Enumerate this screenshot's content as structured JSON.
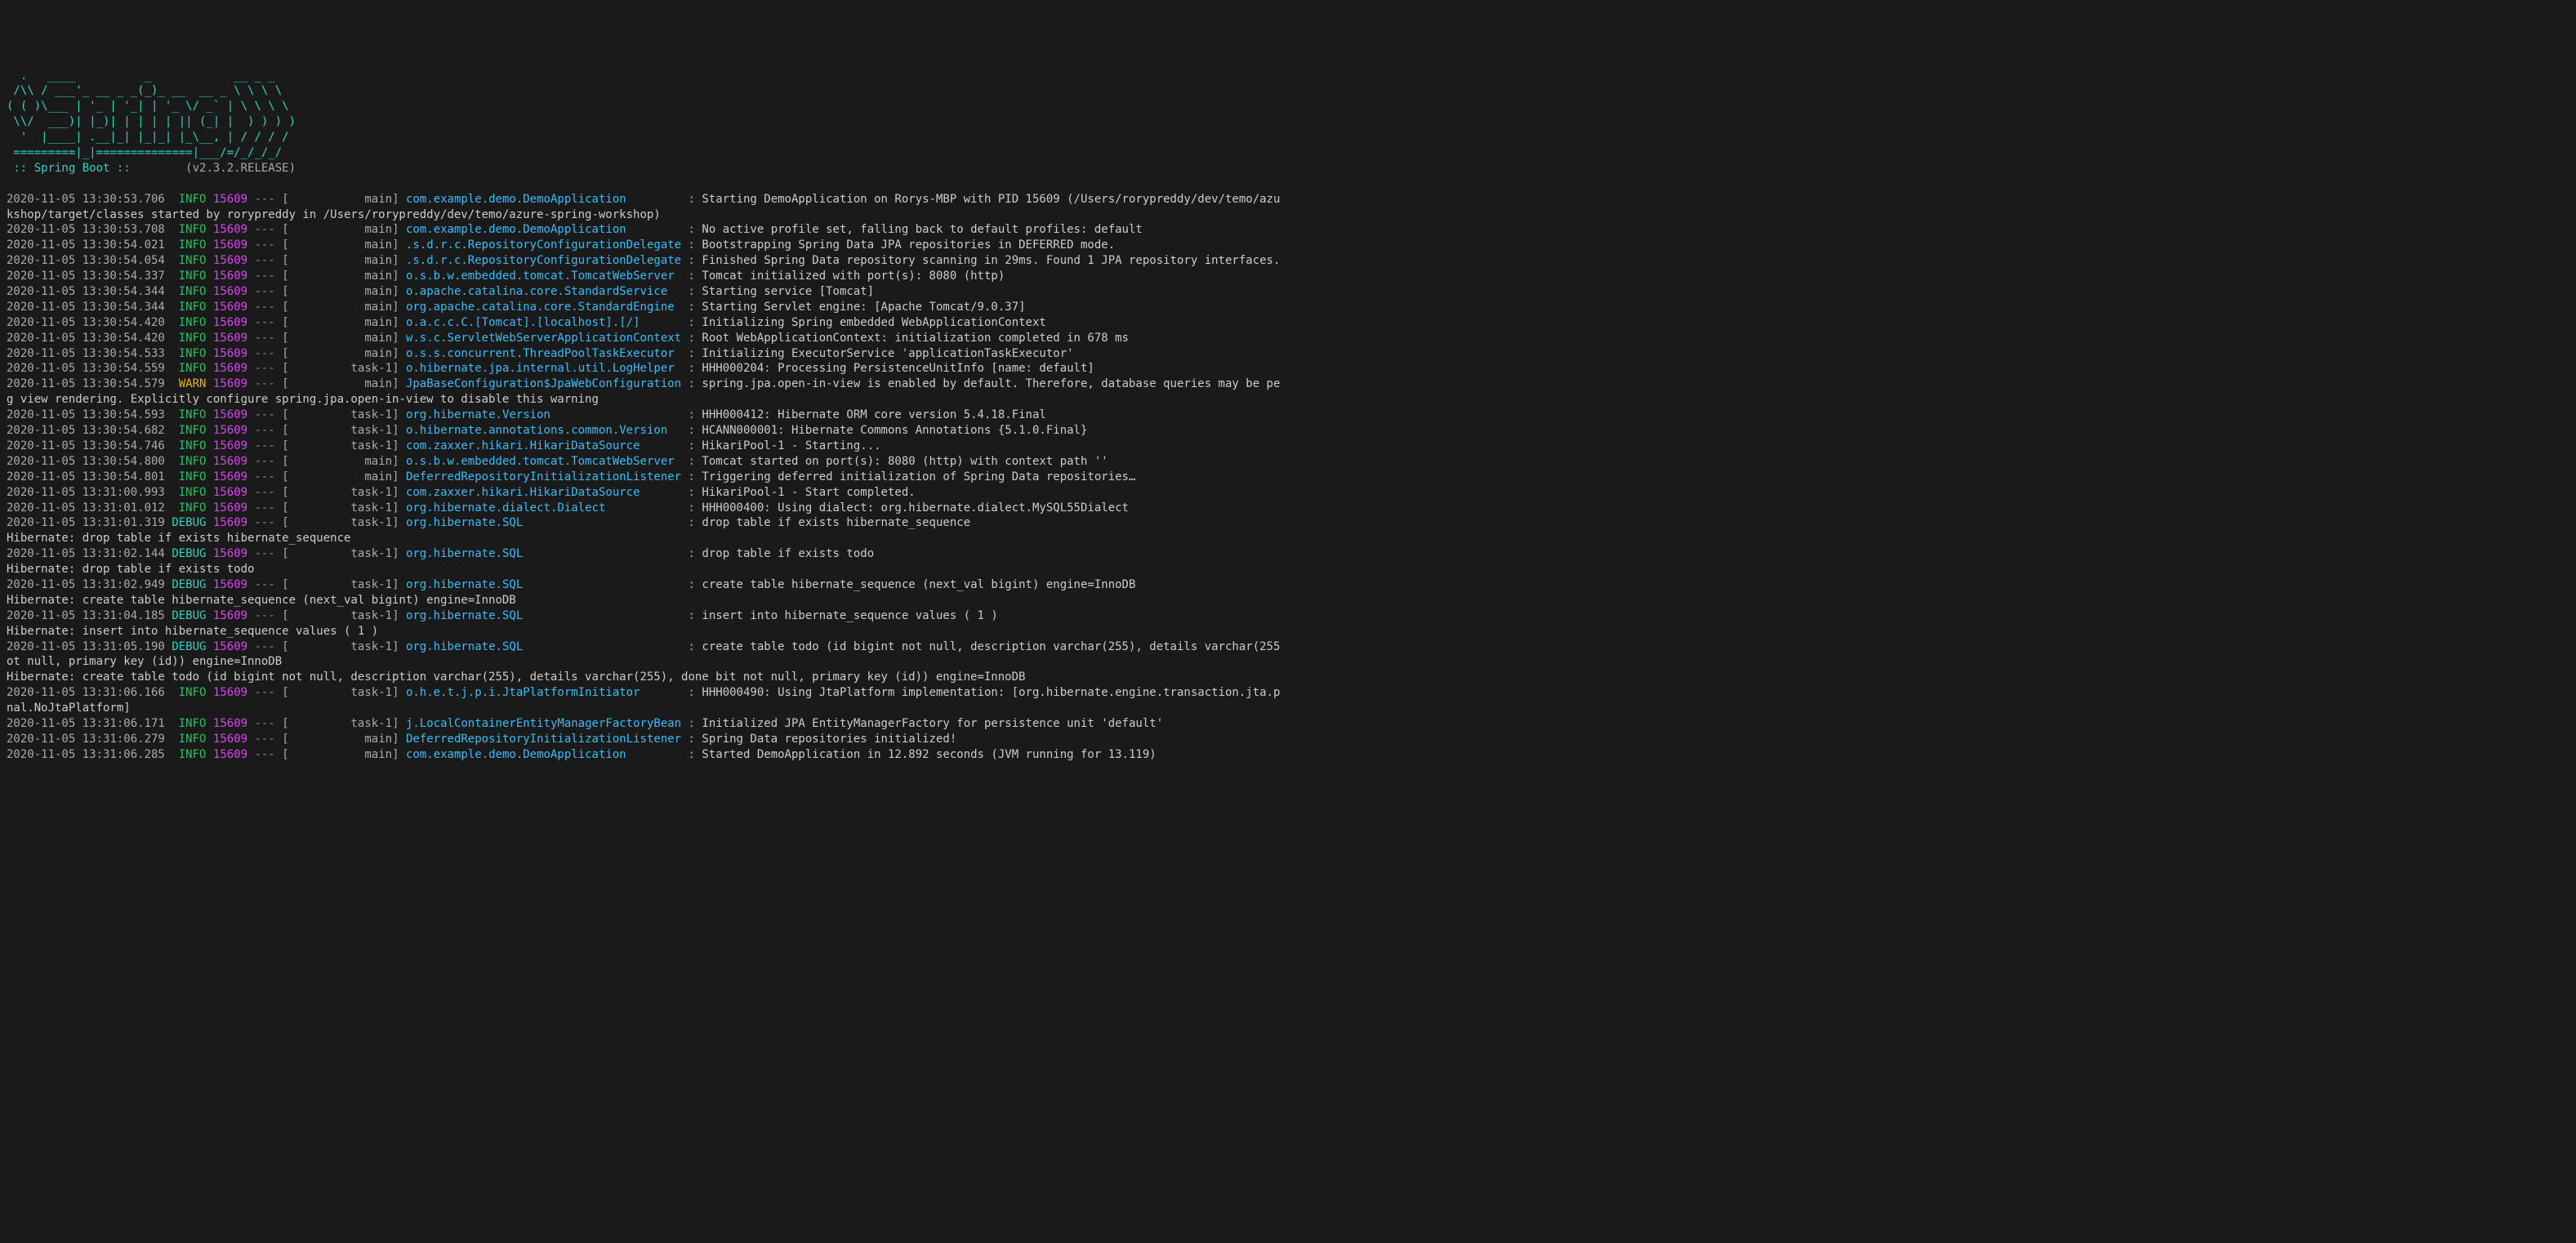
{
  "banner": {
    "art": [
      "  .   ____          _            __ _ _",
      " /\\\\ / ___'_ __ _ _(_)_ __  __ _ \\ \\ \\ \\",
      "( ( )\\___ | '_ | '_| | '_ \\/ _` | \\ \\ \\ \\",
      " \\\\/  ___)| |_)| | | | | || (_| |  ) ) ) )",
      "  '  |____| .__|_| |_|_| |_\\__, | / / / /",
      " =========|_|==============|___/=/_/_/_/"
    ],
    "label": " :: Spring Boot :: ",
    "version": "       (v2.3.2.RELEASE)"
  },
  "lines": [
    {
      "type": "log",
      "ts": "2020-11-05 13:30:53.706",
      "level": "INFO",
      "pid": "15609",
      "thread": "main",
      "logger": "com.example.demo.DemoApplication",
      "msg": "Starting DemoApplication on Rorys-MBP with PID 15609 (/Users/rorypreddy/dev/temo/azu"
    },
    {
      "type": "wrap",
      "text": "kshop/target/classes started by rorypreddy in /Users/rorypreddy/dev/temo/azure-spring-workshop)"
    },
    {
      "type": "log",
      "ts": "2020-11-05 13:30:53.708",
      "level": "INFO",
      "pid": "15609",
      "thread": "main",
      "logger": "com.example.demo.DemoApplication",
      "msg": "No active profile set, falling back to default profiles: default"
    },
    {
      "type": "log",
      "ts": "2020-11-05 13:30:54.021",
      "level": "INFO",
      "pid": "15609",
      "thread": "main",
      "logger": ".s.d.r.c.RepositoryConfigurationDelegate",
      "msg": "Bootstrapping Spring Data JPA repositories in DEFERRED mode."
    },
    {
      "type": "log",
      "ts": "2020-11-05 13:30:54.054",
      "level": "INFO",
      "pid": "15609",
      "thread": "main",
      "logger": ".s.d.r.c.RepositoryConfigurationDelegate",
      "msg": "Finished Spring Data repository scanning in 29ms. Found 1 JPA repository interfaces."
    },
    {
      "type": "log",
      "ts": "2020-11-05 13:30:54.337",
      "level": "INFO",
      "pid": "15609",
      "thread": "main",
      "logger": "o.s.b.w.embedded.tomcat.TomcatWebServer",
      "msg": "Tomcat initialized with port(s): 8080 (http)"
    },
    {
      "type": "log",
      "ts": "2020-11-05 13:30:54.344",
      "level": "INFO",
      "pid": "15609",
      "thread": "main",
      "logger": "o.apache.catalina.core.StandardService",
      "msg": "Starting service [Tomcat]"
    },
    {
      "type": "log",
      "ts": "2020-11-05 13:30:54.344",
      "level": "INFO",
      "pid": "15609",
      "thread": "main",
      "logger": "org.apache.catalina.core.StandardEngine",
      "msg": "Starting Servlet engine: [Apache Tomcat/9.0.37]"
    },
    {
      "type": "log",
      "ts": "2020-11-05 13:30:54.420",
      "level": "INFO",
      "pid": "15609",
      "thread": "main",
      "logger": "o.a.c.c.C.[Tomcat].[localhost].[/]",
      "msg": "Initializing Spring embedded WebApplicationContext"
    },
    {
      "type": "log",
      "ts": "2020-11-05 13:30:54.420",
      "level": "INFO",
      "pid": "15609",
      "thread": "main",
      "logger": "w.s.c.ServletWebServerApplicationContext",
      "msg": "Root WebApplicationContext: initialization completed in 678 ms"
    },
    {
      "type": "log",
      "ts": "2020-11-05 13:30:54.533",
      "level": "INFO",
      "pid": "15609",
      "thread": "main",
      "logger": "o.s.s.concurrent.ThreadPoolTaskExecutor",
      "msg": "Initializing ExecutorService 'applicationTaskExecutor'"
    },
    {
      "type": "log",
      "ts": "2020-11-05 13:30:54.559",
      "level": "INFO",
      "pid": "15609",
      "thread": "task-1",
      "logger": "o.hibernate.jpa.internal.util.LogHelper",
      "msg": "HHH000204: Processing PersistenceUnitInfo [name: default]"
    },
    {
      "type": "log",
      "ts": "2020-11-05 13:30:54.579",
      "level": "WARN",
      "pid": "15609",
      "thread": "main",
      "logger": "JpaBaseConfiguration$JpaWebConfiguration",
      "msg": "spring.jpa.open-in-view is enabled by default. Therefore, database queries may be pe"
    },
    {
      "type": "wrap",
      "text": "g view rendering. Explicitly configure spring.jpa.open-in-view to disable this warning"
    },
    {
      "type": "log",
      "ts": "2020-11-05 13:30:54.593",
      "level": "INFO",
      "pid": "15609",
      "thread": "task-1",
      "logger": "org.hibernate.Version",
      "msg": "HHH000412: Hibernate ORM core version 5.4.18.Final"
    },
    {
      "type": "log",
      "ts": "2020-11-05 13:30:54.682",
      "level": "INFO",
      "pid": "15609",
      "thread": "task-1",
      "logger": "o.hibernate.annotations.common.Version",
      "msg": "HCANN000001: Hibernate Commons Annotations {5.1.0.Final}"
    },
    {
      "type": "log",
      "ts": "2020-11-05 13:30:54.746",
      "level": "INFO",
      "pid": "15609",
      "thread": "task-1",
      "logger": "com.zaxxer.hikari.HikariDataSource",
      "msg": "HikariPool-1 - Starting..."
    },
    {
      "type": "log",
      "ts": "2020-11-05 13:30:54.800",
      "level": "INFO",
      "pid": "15609",
      "thread": "main",
      "logger": "o.s.b.w.embedded.tomcat.TomcatWebServer",
      "msg": "Tomcat started on port(s): 8080 (http) with context path ''"
    },
    {
      "type": "log",
      "ts": "2020-11-05 13:30:54.801",
      "level": "INFO",
      "pid": "15609",
      "thread": "main",
      "logger": "DeferredRepositoryInitializationListener",
      "msg": "Triggering deferred initialization of Spring Data repositories…"
    },
    {
      "type": "log",
      "ts": "2020-11-05 13:31:00.993",
      "level": "INFO",
      "pid": "15609",
      "thread": "task-1",
      "logger": "com.zaxxer.hikari.HikariDataSource",
      "msg": "HikariPool-1 - Start completed."
    },
    {
      "type": "log",
      "ts": "2020-11-05 13:31:01.012",
      "level": "INFO",
      "pid": "15609",
      "thread": "task-1",
      "logger": "org.hibernate.dialect.Dialect",
      "msg": "HHH000400: Using dialect: org.hibernate.dialect.MySQL55Dialect"
    },
    {
      "type": "log",
      "ts": "2020-11-05 13:31:01.319",
      "level": "DEBUG",
      "pid": "15609",
      "thread": "task-1",
      "logger": "org.hibernate.SQL",
      "msg": "drop table if exists hibernate_sequence"
    },
    {
      "type": "wrap",
      "text": "Hibernate: drop table if exists hibernate_sequence"
    },
    {
      "type": "log",
      "ts": "2020-11-05 13:31:02.144",
      "level": "DEBUG",
      "pid": "15609",
      "thread": "task-1",
      "logger": "org.hibernate.SQL",
      "msg": "drop table if exists todo"
    },
    {
      "type": "wrap",
      "text": "Hibernate: drop table if exists todo"
    },
    {
      "type": "log",
      "ts": "2020-11-05 13:31:02.949",
      "level": "DEBUG",
      "pid": "15609",
      "thread": "task-1",
      "logger": "org.hibernate.SQL",
      "msg": "create table hibernate_sequence (next_val bigint) engine=InnoDB"
    },
    {
      "type": "wrap",
      "text": "Hibernate: create table hibernate_sequence (next_val bigint) engine=InnoDB"
    },
    {
      "type": "log",
      "ts": "2020-11-05 13:31:04.185",
      "level": "DEBUG",
      "pid": "15609",
      "thread": "task-1",
      "logger": "org.hibernate.SQL",
      "msg": "insert into hibernate_sequence values ( 1 )"
    },
    {
      "type": "wrap",
      "text": "Hibernate: insert into hibernate_sequence values ( 1 )"
    },
    {
      "type": "log",
      "ts": "2020-11-05 13:31:05.190",
      "level": "DEBUG",
      "pid": "15609",
      "thread": "task-1",
      "logger": "org.hibernate.SQL",
      "msg": "create table todo (id bigint not null, description varchar(255), details varchar(255"
    },
    {
      "type": "wrap",
      "text": "ot null, primary key (id)) engine=InnoDB"
    },
    {
      "type": "wrap",
      "text": "Hibernate: create table todo (id bigint not null, description varchar(255), details varchar(255), done bit not null, primary key (id)) engine=InnoDB"
    },
    {
      "type": "log",
      "ts": "2020-11-05 13:31:06.166",
      "level": "INFO",
      "pid": "15609",
      "thread": "task-1",
      "logger": "o.h.e.t.j.p.i.JtaPlatformInitiator",
      "msg": "HHH000490: Using JtaPlatform implementation: [org.hibernate.engine.transaction.jta.p"
    },
    {
      "type": "wrap",
      "text": "nal.NoJtaPlatform]"
    },
    {
      "type": "log",
      "ts": "2020-11-05 13:31:06.171",
      "level": "INFO",
      "pid": "15609",
      "thread": "task-1",
      "logger": "j.LocalContainerEntityManagerFactoryBean",
      "msg": "Initialized JPA EntityManagerFactory for persistence unit 'default'"
    },
    {
      "type": "log",
      "ts": "2020-11-05 13:31:06.279",
      "level": "INFO",
      "pid": "15609",
      "thread": "main",
      "logger": "DeferredRepositoryInitializationListener",
      "msg": "Spring Data repositories initialized!"
    },
    {
      "type": "log",
      "ts": "2020-11-05 13:31:06.285",
      "level": "INFO",
      "pid": "15609",
      "thread": "main",
      "logger": "com.example.demo.DemoApplication",
      "msg": "Started DemoApplication in 12.892 seconds (JVM running for 13.119)"
    }
  ]
}
